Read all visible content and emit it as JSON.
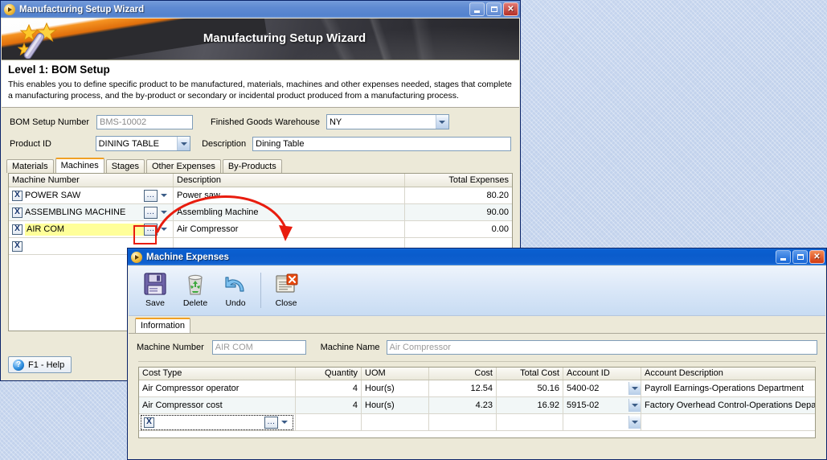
{
  "wizard": {
    "title": "Manufacturing Setup Wizard",
    "banner_title": "Manufacturing Setup Wizard",
    "level_heading": "Level 1: BOM Setup",
    "level_description": "This enables you to define specific product to be manufactured, materials, machines and other expenses needed, stages that complete a manufacturing process, and the by-product or secondary or incidental product produced from a manufacturing process.",
    "fields": {
      "bom_setup_number_label": "BOM Setup Number",
      "bom_setup_number_value": "BMS-10002",
      "warehouse_label": "Finished Goods Warehouse",
      "warehouse_value": "NY",
      "product_id_label": "Product ID",
      "product_id_value": "DINING TABLE",
      "description_label": "Description",
      "description_value": "Dining Table"
    },
    "tabs": [
      {
        "label": "Materials",
        "active": false
      },
      {
        "label": "Machines",
        "active": true
      },
      {
        "label": "Stages",
        "active": false
      },
      {
        "label": "Other Expenses",
        "active": false
      },
      {
        "label": "By-Products",
        "active": false
      }
    ],
    "grid": {
      "columns": [
        "Machine Number",
        "Description",
        "Total Expenses"
      ],
      "rows": [
        {
          "machine_number": "POWER SAW",
          "description": "Power saw",
          "total_expenses": "80.20"
        },
        {
          "machine_number": "ASSEMBLING MACHINE",
          "description": "Assembling Machine",
          "total_expenses": "90.00"
        },
        {
          "machine_number": "AIR COM",
          "description": "Air Compressor",
          "total_expenses": "0.00"
        },
        {
          "machine_number": "",
          "description": "",
          "total_expenses": ""
        }
      ],
      "delete_glyph": "X",
      "lookup_glyph": "..."
    },
    "help_button": "F1 - Help"
  },
  "dialog": {
    "title": "Machine Expenses",
    "toolbar": [
      {
        "label": "Save",
        "icon": "save-floppy-icon"
      },
      {
        "label": "Delete",
        "icon": "recycle-bin-icon"
      },
      {
        "label": "Undo",
        "icon": "undo-arrow-icon"
      },
      {
        "label": "Close",
        "icon": "close-window-icon"
      }
    ],
    "tabs": [
      {
        "label": "Information",
        "active": true
      }
    ],
    "fields": {
      "machine_number_label": "Machine Number",
      "machine_number_value": "AIR COM",
      "machine_name_label": "Machine Name",
      "machine_name_value": "Air Compressor"
    },
    "grid": {
      "columns": [
        "Cost Type",
        "Quantity",
        "UOM",
        "Cost",
        "Total Cost",
        "Account ID",
        "Account Description"
      ],
      "rows": [
        {
          "cost_type": "Air Compressor operator",
          "quantity": "4",
          "uom": "Hour(s)",
          "cost": "12.54",
          "total_cost": "50.16",
          "account_id": "5400-02",
          "account_description": "Payroll Earnings-Operations Department"
        },
        {
          "cost_type": "Air Compressor cost",
          "quantity": "4",
          "uom": "Hour(s)",
          "cost": "4.23",
          "total_cost": "16.92",
          "account_id": "5915-02",
          "account_description": "Factory Overhead Control-Operations Depart"
        },
        {
          "cost_type": "",
          "quantity": "",
          "uom": "",
          "cost": "",
          "total_cost": "",
          "account_id": "",
          "account_description": ""
        }
      ],
      "delete_glyph": "X",
      "lookup_glyph": "..."
    }
  },
  "window_controls": {
    "minimize": "minimize-button",
    "maximize": "maximize-button",
    "close": "close-button",
    "close_glyph": "✕"
  },
  "colors": {
    "desktop": "#c3d4ee",
    "title_active": "#0a5ccc",
    "title_inactive": "#5f8ad2",
    "accent_orange": "#f0a024",
    "highlight_yellow": "#ffff99",
    "annotation_red": "#e81c0e"
  }
}
